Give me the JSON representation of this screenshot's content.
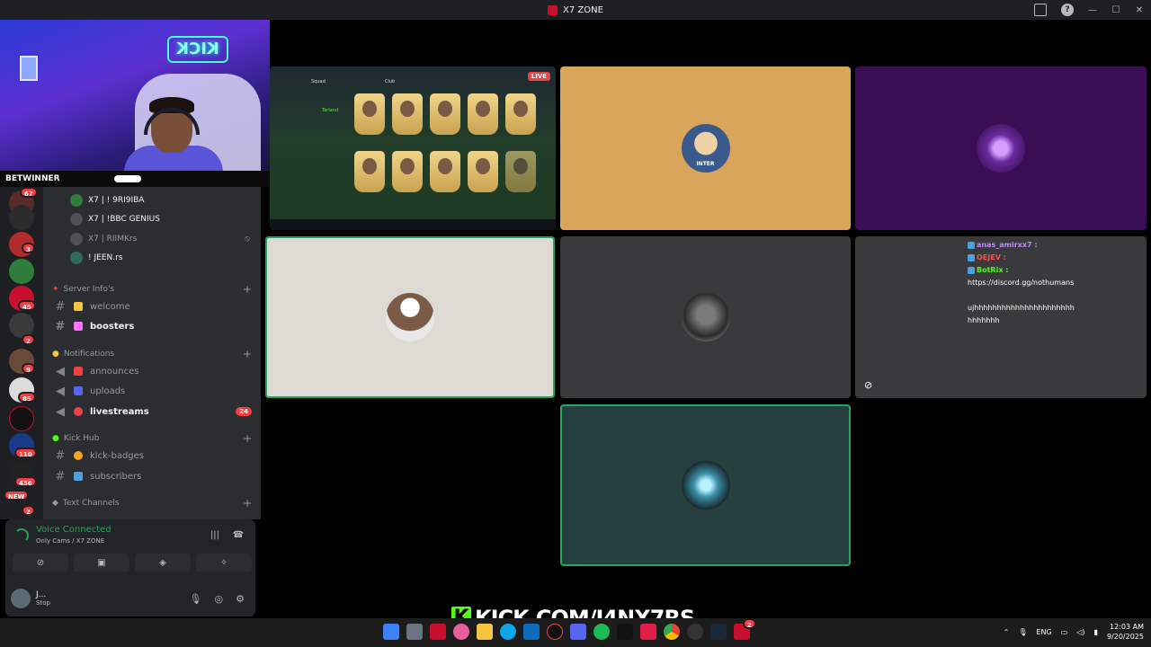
{
  "window": {
    "title": "X7 ZONE"
  },
  "webcam": {
    "neon_sign": "KICK"
  },
  "sponsor": {
    "label": "BETWINNER"
  },
  "server_rail": {
    "badges": [
      "67",
      "3",
      "45",
      "2",
      "9",
      "85",
      "110",
      "436",
      "NEW",
      "2"
    ]
  },
  "voice_users": [
    {
      "name": "X7 | ! 9RI9IBA",
      "dim": false
    },
    {
      "name": "X7 | !BBC GENIUS",
      "dim": false
    },
    {
      "name": "X7 | RIIMKrs",
      "dim": true
    },
    {
      "name": "! JEEN.rs",
      "dim": false
    }
  ],
  "categories": {
    "server_info": "Server Info's",
    "notifications": "Notifications",
    "kick_hub": "Kick Hub",
    "text_channels": "Text Channels"
  },
  "channels": {
    "welcome": "welcome",
    "boosters": "boosters",
    "announces": "announces",
    "uploads": "uploads",
    "livestreams": "livestreams",
    "livestreams_badge": "24",
    "kick_badges": "kick-badges",
    "subscribers": "subscribers"
  },
  "voice_panel": {
    "status": "Voice Connected",
    "location": "Only Cams / X7 ZONE"
  },
  "user": {
    "name": "J...",
    "status": "Stop"
  },
  "game": {
    "live_label": "LIVE",
    "tabs": [
      "Squad",
      "Club"
    ],
    "player_name": "Tarland"
  },
  "tiles": {
    "inter_avatar_text": "INTER"
  },
  "chat_overlay": {
    "lines": [
      {
        "user": "anas_amirxx7 :",
        "text": "",
        "color": "#c389ff"
      },
      {
        "user": "OEJEV :",
        "text": "",
        "color": "#ff4f4f"
      },
      {
        "user": "BotRix :",
        "text": "",
        "color": "#53fc18"
      },
      {
        "user": "",
        "text": "https://discord.gg/nothumans",
        "color": "#ffffff"
      },
      {
        "user": "",
        "text": "ujhhhhhhhhhhhhhhhhhhhhhhhhhhhhh",
        "color": "#ffffff"
      }
    ]
  },
  "kick_banner": {
    "k": "K",
    "text": "KICK.COM/J4NX7RS"
  },
  "taskbar": {
    "lang": "ENG",
    "time": "12:03 AM",
    "date": "9/20/2025",
    "app_badge": "2"
  },
  "colors": {
    "tile_orange": "#d9a55a",
    "tile_purple": "#3b0d54",
    "tile_light": "#dedbd5",
    "tile_gray": "#3a3a3c",
    "tile_teal": "#25403f",
    "speaking": "#23a55a",
    "kick_green": "#53fc18"
  }
}
